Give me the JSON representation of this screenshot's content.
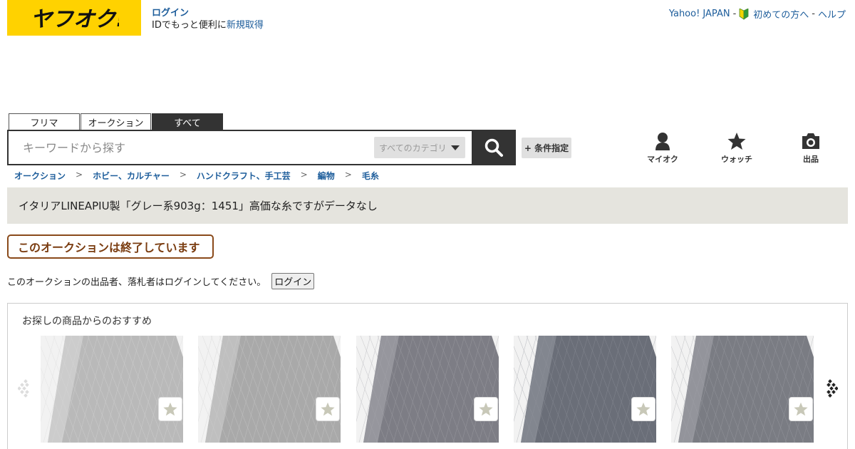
{
  "header": {
    "logo_text": "ヤフオク!",
    "login_link": "ログイン",
    "login_promo": "IDでもっと便利に",
    "signup_link": "新規取得",
    "top_links": {
      "yahoo": "Yahoo! JAPAN",
      "sep1": "-",
      "beginner": "初めての方へ",
      "sep2": "-",
      "help": "ヘルプ"
    }
  },
  "search": {
    "tabs": [
      "フリマ",
      "オークション",
      "すべて"
    ],
    "active_tab": "すべて",
    "placeholder": "キーワードから探す",
    "category_selected": "すべてのカテゴリ",
    "condition_button": "+ 条件指定"
  },
  "nav": {
    "myauction": "マイオク",
    "watch": "ウォッチ",
    "sell": "出品"
  },
  "breadcrumb": [
    "オークション",
    "ホビー、カルチャー",
    "ハンドクラフト、手工芸",
    "編物",
    "毛糸"
  ],
  "breadcrumb_separator": ">",
  "item": {
    "title": "イタリアLINEAPIU製「グレー系903g：1451」高価な糸ですがデータなし",
    "status_banner": "このオークションは終了しています",
    "login_note": "このオークションの出品者、落札者はログインしてください。",
    "login_button": "ログイン"
  },
  "recommendations": {
    "title": "お探しの商品からのおすすめ",
    "items": [
      {
        "color": "#b9b9b9",
        "shade": "#d9d9d9"
      },
      {
        "color": "#a9a9a9",
        "shade": "#cfcfcf"
      },
      {
        "color": "#7d7d85",
        "shade": "#a7a7ad"
      },
      {
        "color": "#6a6e78",
        "shade": "#93969e"
      },
      {
        "color": "#7a7c83",
        "shade": "#a3a5ab"
      }
    ]
  },
  "colors": {
    "brand_yellow": "#ffd200",
    "link_blue": "#1d5d9b",
    "dark": "#333333",
    "ended_brown": "#7a3c10"
  }
}
